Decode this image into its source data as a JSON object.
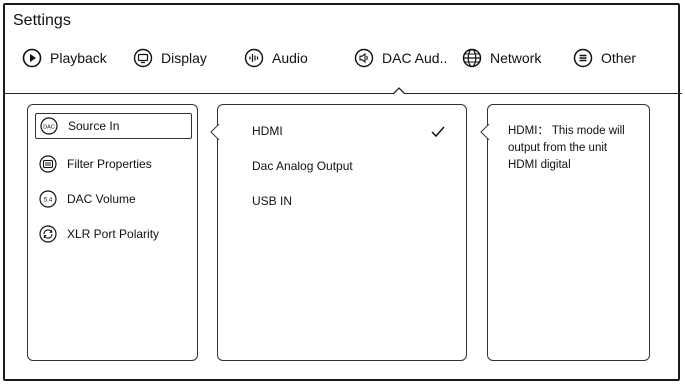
{
  "header": {
    "title": "Settings"
  },
  "tabs": [
    {
      "label": "Playback",
      "icon": "play-circle-icon"
    },
    {
      "label": "Display",
      "icon": "monitor-icon"
    },
    {
      "label": "Audio",
      "icon": "waveform-icon"
    },
    {
      "label": "DAC Aud..",
      "icon": "speaker-icon",
      "selected": true
    },
    {
      "label": "Network",
      "icon": "globe-icon"
    },
    {
      "label": "Other",
      "icon": "menu-lines-icon"
    }
  ],
  "menu": {
    "items": [
      {
        "label": "Source In",
        "icon_text": "DAC",
        "icon": "dac-icon",
        "selected": true
      },
      {
        "label": "Filter Properties",
        "icon": "filter-icon"
      },
      {
        "label": "DAC Volume",
        "icon_text": "5.4",
        "icon": "volume-level-icon"
      },
      {
        "label": "XLR Port Polarity",
        "icon": "polarity-icon"
      }
    ]
  },
  "options": {
    "items": [
      {
        "label": "HDMI",
        "checked": true
      },
      {
        "label": "Dac Analog Output"
      },
      {
        "label": "USB IN"
      }
    ]
  },
  "description": {
    "text": "HDMI： This mode will output from the unit HDMI digital"
  }
}
